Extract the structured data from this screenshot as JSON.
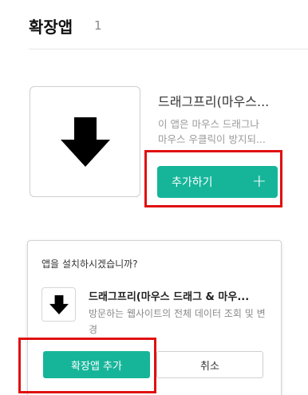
{
  "header": {
    "title": "확장앱",
    "count": "1"
  },
  "card": {
    "icon": "down-arrow-icon",
    "name": "드래그프리(마우스...",
    "desc_line1": "이 앱은 마우스 드래그나",
    "desc_line2": "마우스 우클릭이 방지되...",
    "add_label": "추가하기",
    "add_icon": "plus-icon"
  },
  "dialog": {
    "question": "앱을 설치하시겠습니까?",
    "app_name": "드래그프리(마우스 드래그 & 마우...",
    "permission": "방문하는 웹사이트의 전체 데이터 조회 및 변경",
    "install_label": "확장앱 추가",
    "cancel_label": "취소"
  },
  "colors": {
    "accent": "#16b59a",
    "highlight": "#e01010"
  }
}
